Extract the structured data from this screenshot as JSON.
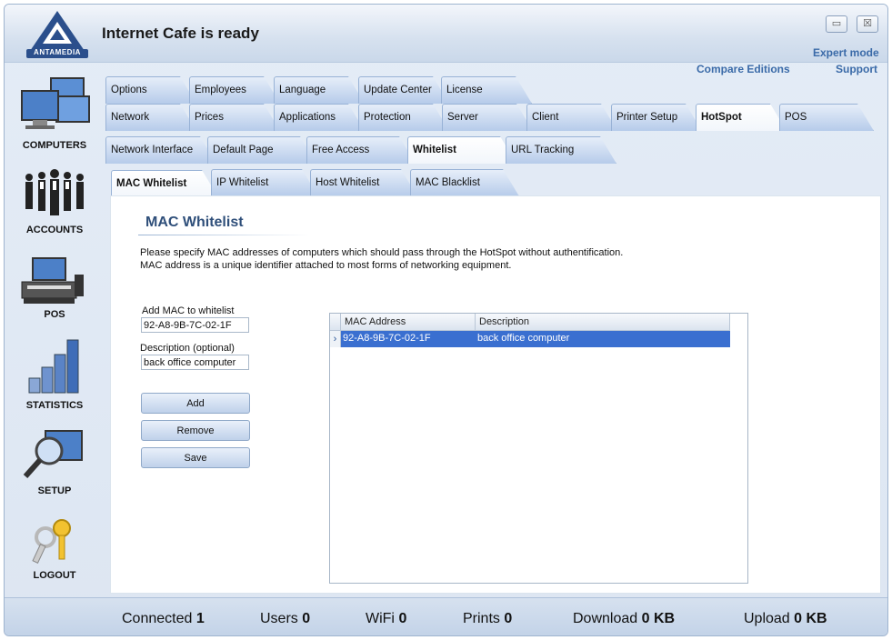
{
  "app": {
    "title": "Internet Cafe is ready",
    "logo_text": "ANTAMEDIA",
    "minimize_glyph": "▭",
    "close_glyph": "☒",
    "links": {
      "expert_mode": "Expert mode",
      "compare_editions": "Compare Editions",
      "support": "Support"
    }
  },
  "sidebar": {
    "items": [
      {
        "label": "COMPUTERS",
        "icon": "computers-icon"
      },
      {
        "label": "ACCOUNTS",
        "icon": "accounts-icon"
      },
      {
        "label": "POS",
        "icon": "pos-icon"
      },
      {
        "label": "STATISTICS",
        "icon": "statistics-icon"
      },
      {
        "label": "SETUP",
        "icon": "setup-icon"
      },
      {
        "label": "LOGOUT",
        "icon": "logout-icon"
      }
    ]
  },
  "tabs": {
    "row1": [
      "Options",
      "Employees",
      "Language",
      "Update Center",
      "License"
    ],
    "row2": [
      "Network",
      "Prices",
      "Applications",
      "Protection",
      "Server",
      "Client",
      "Printer Setup",
      "HotSpot",
      "POS"
    ],
    "row3": [
      "Network Interface",
      "Default Page",
      "Free Access",
      "Whitelist",
      "URL Tracking"
    ],
    "row4": [
      "MAC Whitelist",
      "IP Whitelist",
      "Host Whitelist",
      "MAC Blacklist"
    ],
    "active": {
      "row2": "HotSpot",
      "row3": "Whitelist",
      "row4": "MAC Whitelist"
    }
  },
  "panel": {
    "title": "MAC Whitelist",
    "description_line1": "Please specify MAC addresses of computers which should pass through the HotSpot without authentification.",
    "description_line2": "MAC address is a unique identifier attached to most forms of networking equipment.",
    "mac_label": "Add MAC to whitelist",
    "mac_value": "92-A8-9B-7C-02-1F",
    "desc_label": "Description (optional)",
    "desc_value": "back office computer",
    "buttons": {
      "add": "Add",
      "remove": "Remove",
      "save": "Save"
    },
    "grid": {
      "columns": [
        "MAC Address",
        "Description"
      ],
      "rows": [
        {
          "mac": "92-A8-9B-7C-02-1F",
          "description": "back office computer",
          "indicator": "›"
        }
      ]
    }
  },
  "status_bar": [
    {
      "label": "Connected",
      "value": "1"
    },
    {
      "label": "Users",
      "value": "0"
    },
    {
      "label": "WiFi",
      "value": "0"
    },
    {
      "label": "Prints",
      "value": "0"
    },
    {
      "label": "Download",
      "value": "0 KB"
    },
    {
      "label": "Upload",
      "value": "0 KB"
    }
  ],
  "colors": {
    "accent": "#3a6fd0",
    "title_blue": "#2f4f7a",
    "link_blue": "#3a6aa8"
  }
}
